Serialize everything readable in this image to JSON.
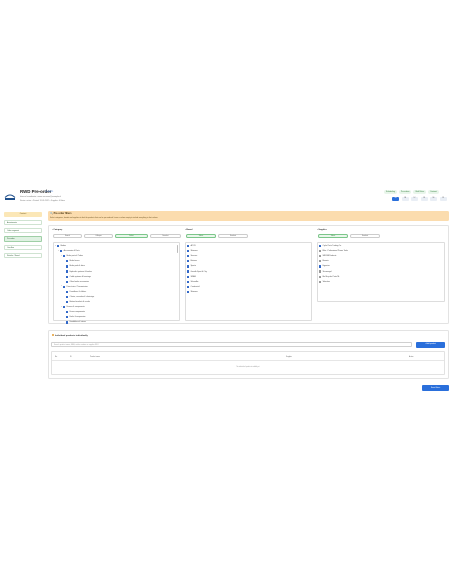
{
  "header": {
    "title": "RWD Pre-order",
    "tag_prefix": "Filter list •",
    "tag_link": "ID 45321",
    "meta1": "Internal coordinator: name.surname@example.nl",
    "meta2": "Status: active • Period: 12-01-2025 • Supplier: 4 filters",
    "pills": [
      "Scheduling",
      "Pre-orders",
      "Shift Rules",
      "Contract"
    ],
    "pages": [
      "1A",
      "1B",
      "1C",
      "1D",
      "1E",
      "1F"
    ]
  },
  "sidebar": {
    "heading": "Contact",
    "items": [
      "Assortments",
      "Order segment",
      "Pre-order",
      "Overflow",
      "Retailer / Brand"
    ],
    "active_index": 2
  },
  "banner": {
    "title": "Pre-order filters",
    "text": "Select categories, brands and suppliers to limit the products that can be pre-ordered. Leave a column empty to include everything in that column."
  },
  "filters": {
    "category": {
      "title": "Category",
      "buttons": [
        "Search",
        "Collapse",
        "Select",
        "Deselect"
      ],
      "tree": [
        {
          "label": "Bodies",
          "level": 0,
          "checked": true,
          "toggle": "▾"
        },
        {
          "label": "Accessories & Parts",
          "level": 1,
          "checked": true,
          "toggle": "▾"
        },
        {
          "label": "Brake parts & Tubes",
          "level": 2,
          "checked": true,
          "toggle": "▾"
        },
        {
          "label": "Brake levers",
          "level": 3,
          "checked": true,
          "toggle": ""
        },
        {
          "label": "Brake pads & discs",
          "level": 3,
          "checked": true,
          "toggle": ""
        },
        {
          "label": "Hydraulic systems & brakes",
          "level": 3,
          "checked": true,
          "toggle": ""
        },
        {
          "label": "Cable systems & housings",
          "level": 3,
          "checked": true,
          "toggle": ""
        },
        {
          "label": "Other brake accessories",
          "level": 3,
          "checked": true,
          "toggle": ""
        },
        {
          "label": "Drive trains / Transmission",
          "level": 2,
          "checked": true,
          "toggle": "▾"
        },
        {
          "label": "Derailleurs & shifters",
          "level": 3,
          "checked": true,
          "toggle": ""
        },
        {
          "label": "Chains, cassettes & chainrings",
          "level": 3,
          "checked": true,
          "toggle": ""
        },
        {
          "label": "Bottom brackets & cranks",
          "level": 3,
          "checked": true,
          "toggle": ""
        },
        {
          "label": "Frames & components",
          "level": 2,
          "checked": true,
          "toggle": "▾"
        },
        {
          "label": "Frame components",
          "level": 3,
          "checked": true,
          "toggle": ""
        },
        {
          "label": "Forks & suspension",
          "level": 3,
          "checked": true,
          "toggle": ""
        },
        {
          "label": "Handlebars & stems",
          "level": 3,
          "checked": true,
          "toggle": ""
        }
      ]
    },
    "brand": {
      "title": "Brand",
      "buttons": [
        "Select",
        "Deselect"
      ],
      "items": [
        "ACCS",
        "Shimano",
        "Sunrace",
        "Batavus",
        "Sparta",
        "Gazelle Sport & City",
        "SRAM",
        "Schwalbe",
        "Continental",
        "Shimano"
      ]
    },
    "supplier": {
      "title": "Supplier",
      "buttons": [
        "Select",
        "Deselect"
      ],
      "items": [
        {
          "label": "Cycle Parts Trading Co.",
          "checked": true
        },
        {
          "label": "Elite - Professional Power Tools",
          "checked": false
        },
        {
          "label": "WESTA Products",
          "checked": false
        },
        {
          "label": "Bavaria",
          "checked": false
        },
        {
          "label": "Hyperion",
          "checked": true
        },
        {
          "label": "Sturmvogel",
          "checked": false
        },
        {
          "label": "Bix Bicycles Parts NL",
          "checked": false
        },
        {
          "label": "Velocitas",
          "checked": false
        }
      ]
    }
  },
  "products": {
    "title": "Individual products individually",
    "search_placeholder": "Search product name, EAN, article number or supplier SKU",
    "add_label": "+ Add product",
    "columns": [
      "No.",
      "ID",
      "Product name",
      "Supplier",
      "Action"
    ],
    "empty": "No individual products added yet"
  },
  "save_label": "Save filters",
  "colors": {
    "accent": "#2a6fdb",
    "banner": "#fbdcae",
    "green": "#2f7d3a"
  }
}
